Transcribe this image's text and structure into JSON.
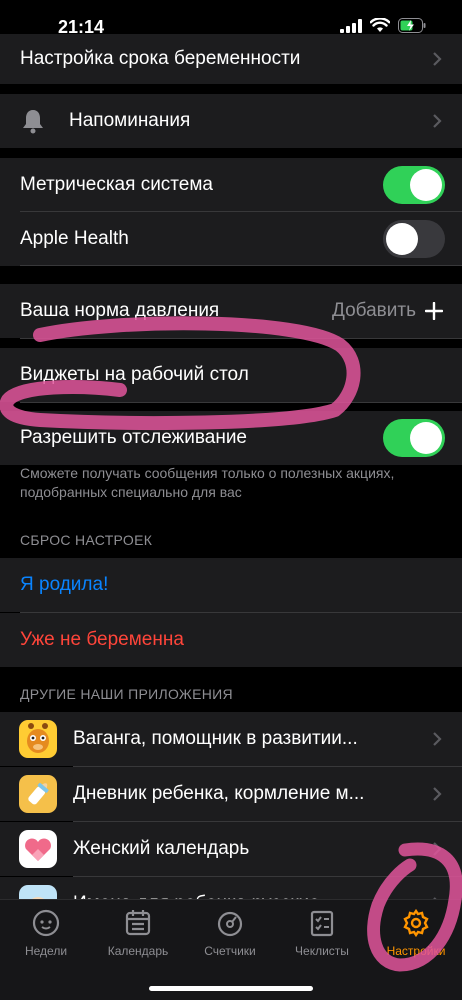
{
  "status": {
    "time": "21:14"
  },
  "settings": {
    "pregnancy_term": "Настройка срока беременности",
    "reminders": "Напоминания",
    "metric": "Метрическая система",
    "metric_on": true,
    "apple_health": "Apple Health",
    "apple_health_on": false,
    "pressure": "Ваша норма давления",
    "pressure_action": "Добавить",
    "widgets": "Виджеты на рабочий стол",
    "tracking": "Разрешить отслеживание",
    "tracking_on": true,
    "tracking_note": "Сможете получать сообщения только о полезных акциях, подобранных специально для вас"
  },
  "reset": {
    "header": "СБРОС НАСТРОЕК",
    "gave_birth": "Я родила!",
    "not_pregnant": "Уже не беременна"
  },
  "apps": {
    "header": "ДРУГИЕ НАШИ ПРИЛОЖЕНИЯ",
    "items": [
      {
        "label": "Ваганга, помощник в развитии...",
        "icon": "giraffe-app-icon"
      },
      {
        "label": "Дневник ребенка, кормление м...",
        "icon": "baby-bottle-app-icon"
      },
      {
        "label": "Женский календарь",
        "icon": "heart-app-icon"
      },
      {
        "label": "Имена для ребенка русские",
        "icon": "names-app-icon"
      }
    ]
  },
  "tabs": [
    {
      "label": "Недели",
      "icon": "baby-face-icon"
    },
    {
      "label": "Календарь",
      "icon": "calendar-icon"
    },
    {
      "label": "Счетчики",
      "icon": "stopwatch-icon"
    },
    {
      "label": "Чеклисты",
      "icon": "checklist-icon"
    },
    {
      "label": "Настройки",
      "icon": "gear-icon"
    }
  ],
  "colors": {
    "accent_orange": "#ff9500",
    "toggle_green": "#30d158",
    "link_blue": "#0a84ff",
    "destructive_red": "#ff453a",
    "annotation_pink": "#e0559b"
  }
}
